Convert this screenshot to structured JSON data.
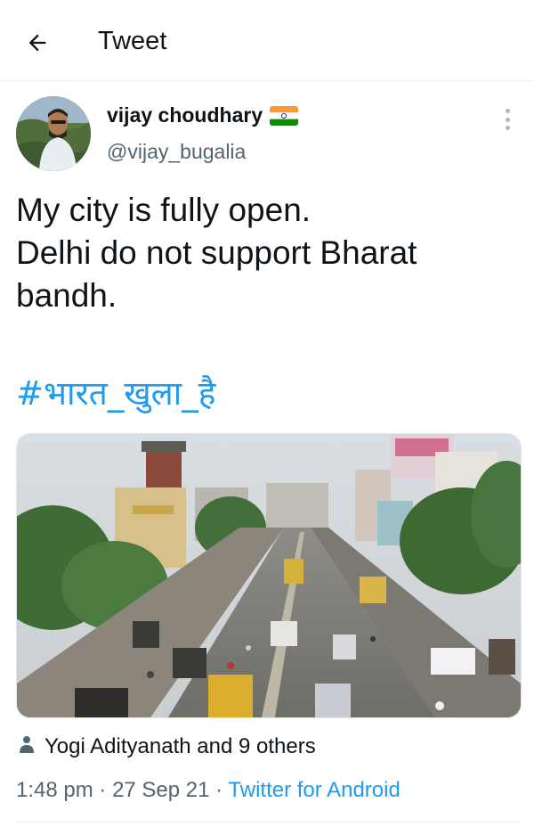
{
  "header": {
    "title": "Tweet",
    "back_icon": "arrow-left-icon"
  },
  "author": {
    "display_name": "vijay choudhary",
    "flag_icon": "india-flag-icon",
    "handle": "@vijay_bugalia"
  },
  "tweet": {
    "lines": [
      "My city is fully open.",
      "Delhi do not support Bharat",
      "bandh."
    ],
    "hashtag": "#भारत_खुला_है"
  },
  "likes": {
    "text": "Yogi Adityanath and 9 others",
    "icon": "person-icon"
  },
  "meta": {
    "time": "1:48 pm",
    "separator": "·",
    "date": "27 Sep 21",
    "source": "Twitter for Android"
  },
  "colors": {
    "link": "#1d9bf0",
    "secondary_text": "#536471",
    "primary_text": "#0f1419",
    "divider": "#e6ecf0"
  }
}
